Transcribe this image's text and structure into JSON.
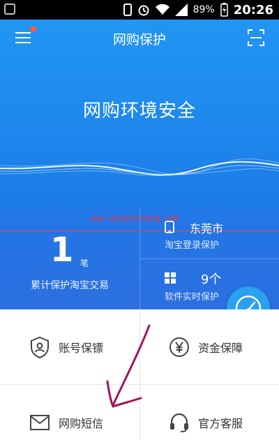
{
  "status_bar": {
    "battery_percent": "89%",
    "time": "20:26",
    "icons": [
      "phone-outline-icon",
      "alarm-icon",
      "wifi-icon",
      "signal-icon",
      "battery-charging-icon"
    ]
  },
  "header": {
    "title": "网购保护",
    "menu_icon": "menu-icon",
    "scan_icon": "scan-icon"
  },
  "hero": {
    "headline": "网购环境安全"
  },
  "stats": {
    "protected_count": "1",
    "protected_unit": "笔",
    "protected_label": "累计保护淘宝交易",
    "location": "东莞市",
    "location_label": "淘宝登录保护",
    "software_count": "9个",
    "software_label": "软件实时保护"
  },
  "overlay": {
    "watermark": "www.qinpinchang.com"
  },
  "features": [
    {
      "label": "账号保镖",
      "icon": "shield-user-icon"
    },
    {
      "label": "资金保障",
      "icon": "yen-circle-icon"
    },
    {
      "label": "网购短信",
      "icon": "mail-icon"
    },
    {
      "label": "官方客服",
      "icon": "headset-icon"
    }
  ],
  "colors": {
    "primary": "#1e87ec",
    "accent_dot": "#ff5a3c",
    "fab": "#2aa0f0",
    "annotation": "#a0145a"
  }
}
